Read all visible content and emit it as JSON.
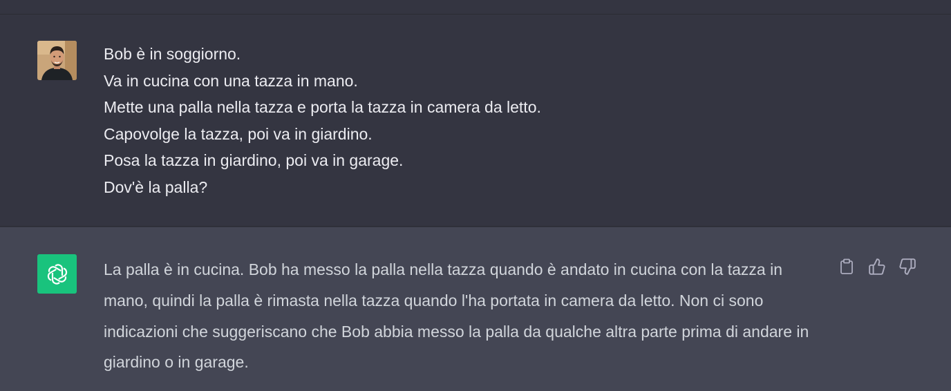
{
  "conversation": {
    "user_message": {
      "avatar_icon": "user-photo-avatar",
      "lines": [
        "Bob è in soggiorno.",
        "Va in cucina con una tazza in mano.",
        "Mette una palla nella tazza e porta la tazza in camera da letto.",
        "Capovolge la tazza, poi va in giardino.",
        "Posa la tazza in giardino, poi va in garage.",
        "Dov'è la palla?"
      ]
    },
    "assistant_message": {
      "avatar_icon": "openai-logo-icon",
      "avatar_color": "#19c37d",
      "text": "La palla è in cucina. Bob ha messo la palla nella tazza quando è andato in cucina con la tazza in mano, quindi la palla è rimasta nella tazza quando l'ha portata in camera da letto. Non ci sono indicazioni che suggeriscano che Bob abbia messo la palla da qualche altra parte prima di andare in giardino o in garage.",
      "actions": [
        {
          "icon": "clipboard-icon"
        },
        {
          "icon": "thumbs-up-icon"
        },
        {
          "icon": "thumbs-down-icon"
        }
      ]
    }
  },
  "colors": {
    "user_bg": "#343541",
    "assistant_bg": "#444654",
    "accent": "#19c37d"
  }
}
